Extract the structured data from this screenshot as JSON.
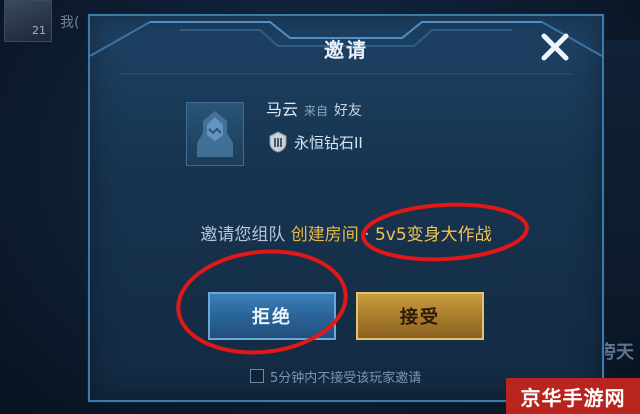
{
  "background": {
    "avatar_count": "21",
    "left_text": "我(",
    "right_text": "旁天"
  },
  "dialog": {
    "title": "邀请",
    "close_icon": "close-icon"
  },
  "inviter": {
    "name": "马云",
    "from_label": "来自",
    "relation": "好友",
    "rank": "永恒钻石II",
    "rank_icon": "rank-badge-icon"
  },
  "invite": {
    "prefix": "邀请您组队",
    "room": "创建房间",
    "separator": "·",
    "mode": "5v5变身大作战"
  },
  "buttons": {
    "reject": "拒绝",
    "accept": "接受"
  },
  "options": {
    "no_invite_label": "5分钟内不接受该玩家邀请",
    "no_invite_checked": false
  },
  "watermark": {
    "text": "京华手游网"
  },
  "colors": {
    "accent_gold": "#f0c353",
    "annotation_red": "#e01818",
    "reject_blue": "#2a6498",
    "accept_gold": "#a77a2c"
  }
}
